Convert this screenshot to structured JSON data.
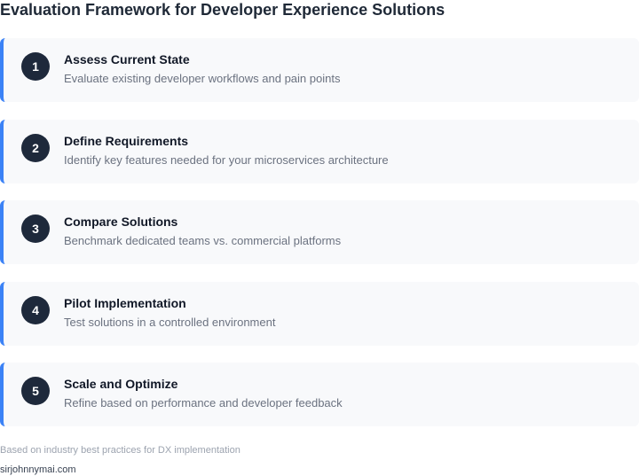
{
  "title": "Evaluation Framework for Developer Experience Solutions",
  "steps": [
    {
      "number": "1",
      "title": "Assess Current State",
      "description": "Evaluate existing developer workflows and pain points"
    },
    {
      "number": "2",
      "title": "Define Requirements",
      "description": "Identify key features needed for your microservices architecture"
    },
    {
      "number": "3",
      "title": "Compare Solutions",
      "description": "Benchmark dedicated teams vs. commercial platforms"
    },
    {
      "number": "4",
      "title": "Pilot Implementation",
      "description": "Test solutions in a controlled environment"
    },
    {
      "number": "5",
      "title": "Scale and Optimize",
      "description": "Refine based on performance and developer feedback"
    }
  ],
  "footnote": "Based on industry best practices for DX implementation",
  "credit": "sirjohnnymai.com",
  "colors": {
    "accent": "#3b82f6",
    "badge": "#1e293b",
    "card_background": "#f8f9fb"
  }
}
